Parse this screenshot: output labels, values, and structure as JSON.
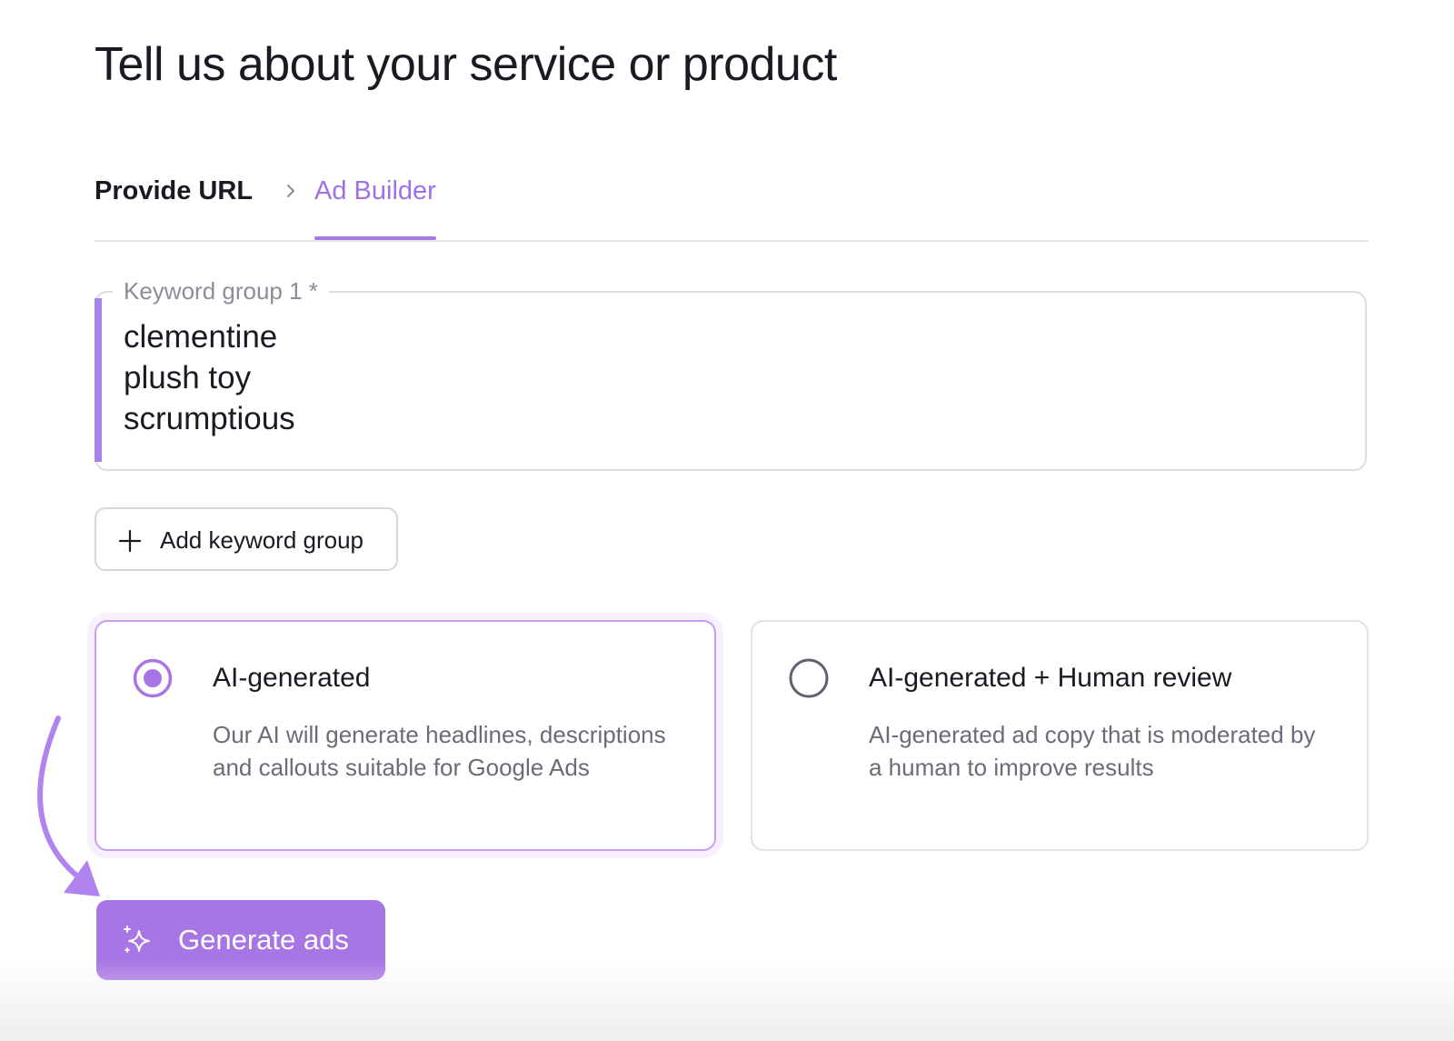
{
  "page": {
    "title": "Tell us about your service or product"
  },
  "tabs": {
    "items": [
      {
        "label": "Provide URL",
        "active": false
      },
      {
        "label": "Ad Builder",
        "active": true
      }
    ],
    "separator_icon": "chevron-right-icon"
  },
  "keyword_group": {
    "label": "Keyword group 1",
    "required_marker": "*",
    "keywords": [
      "clementine",
      "plush toy",
      "scrumptious"
    ]
  },
  "add_keyword_group": {
    "icon": "plus-icon",
    "label": "Add keyword group"
  },
  "options": [
    {
      "title": "AI-generated",
      "description": "Our AI will generate headlines, descriptions and callouts suitable for Google Ads",
      "selected": true
    },
    {
      "title": "AI-generated + Human review",
      "description": "AI-generated ad copy that is moderated by a human to improve results",
      "selected": false
    }
  ],
  "generate": {
    "icon": "sparkle-icon",
    "label": "Generate ads"
  },
  "colors": {
    "accent": "#a875e4",
    "accent_text": "#a071e6",
    "text": "#191b23",
    "muted": "#6a6d78"
  }
}
